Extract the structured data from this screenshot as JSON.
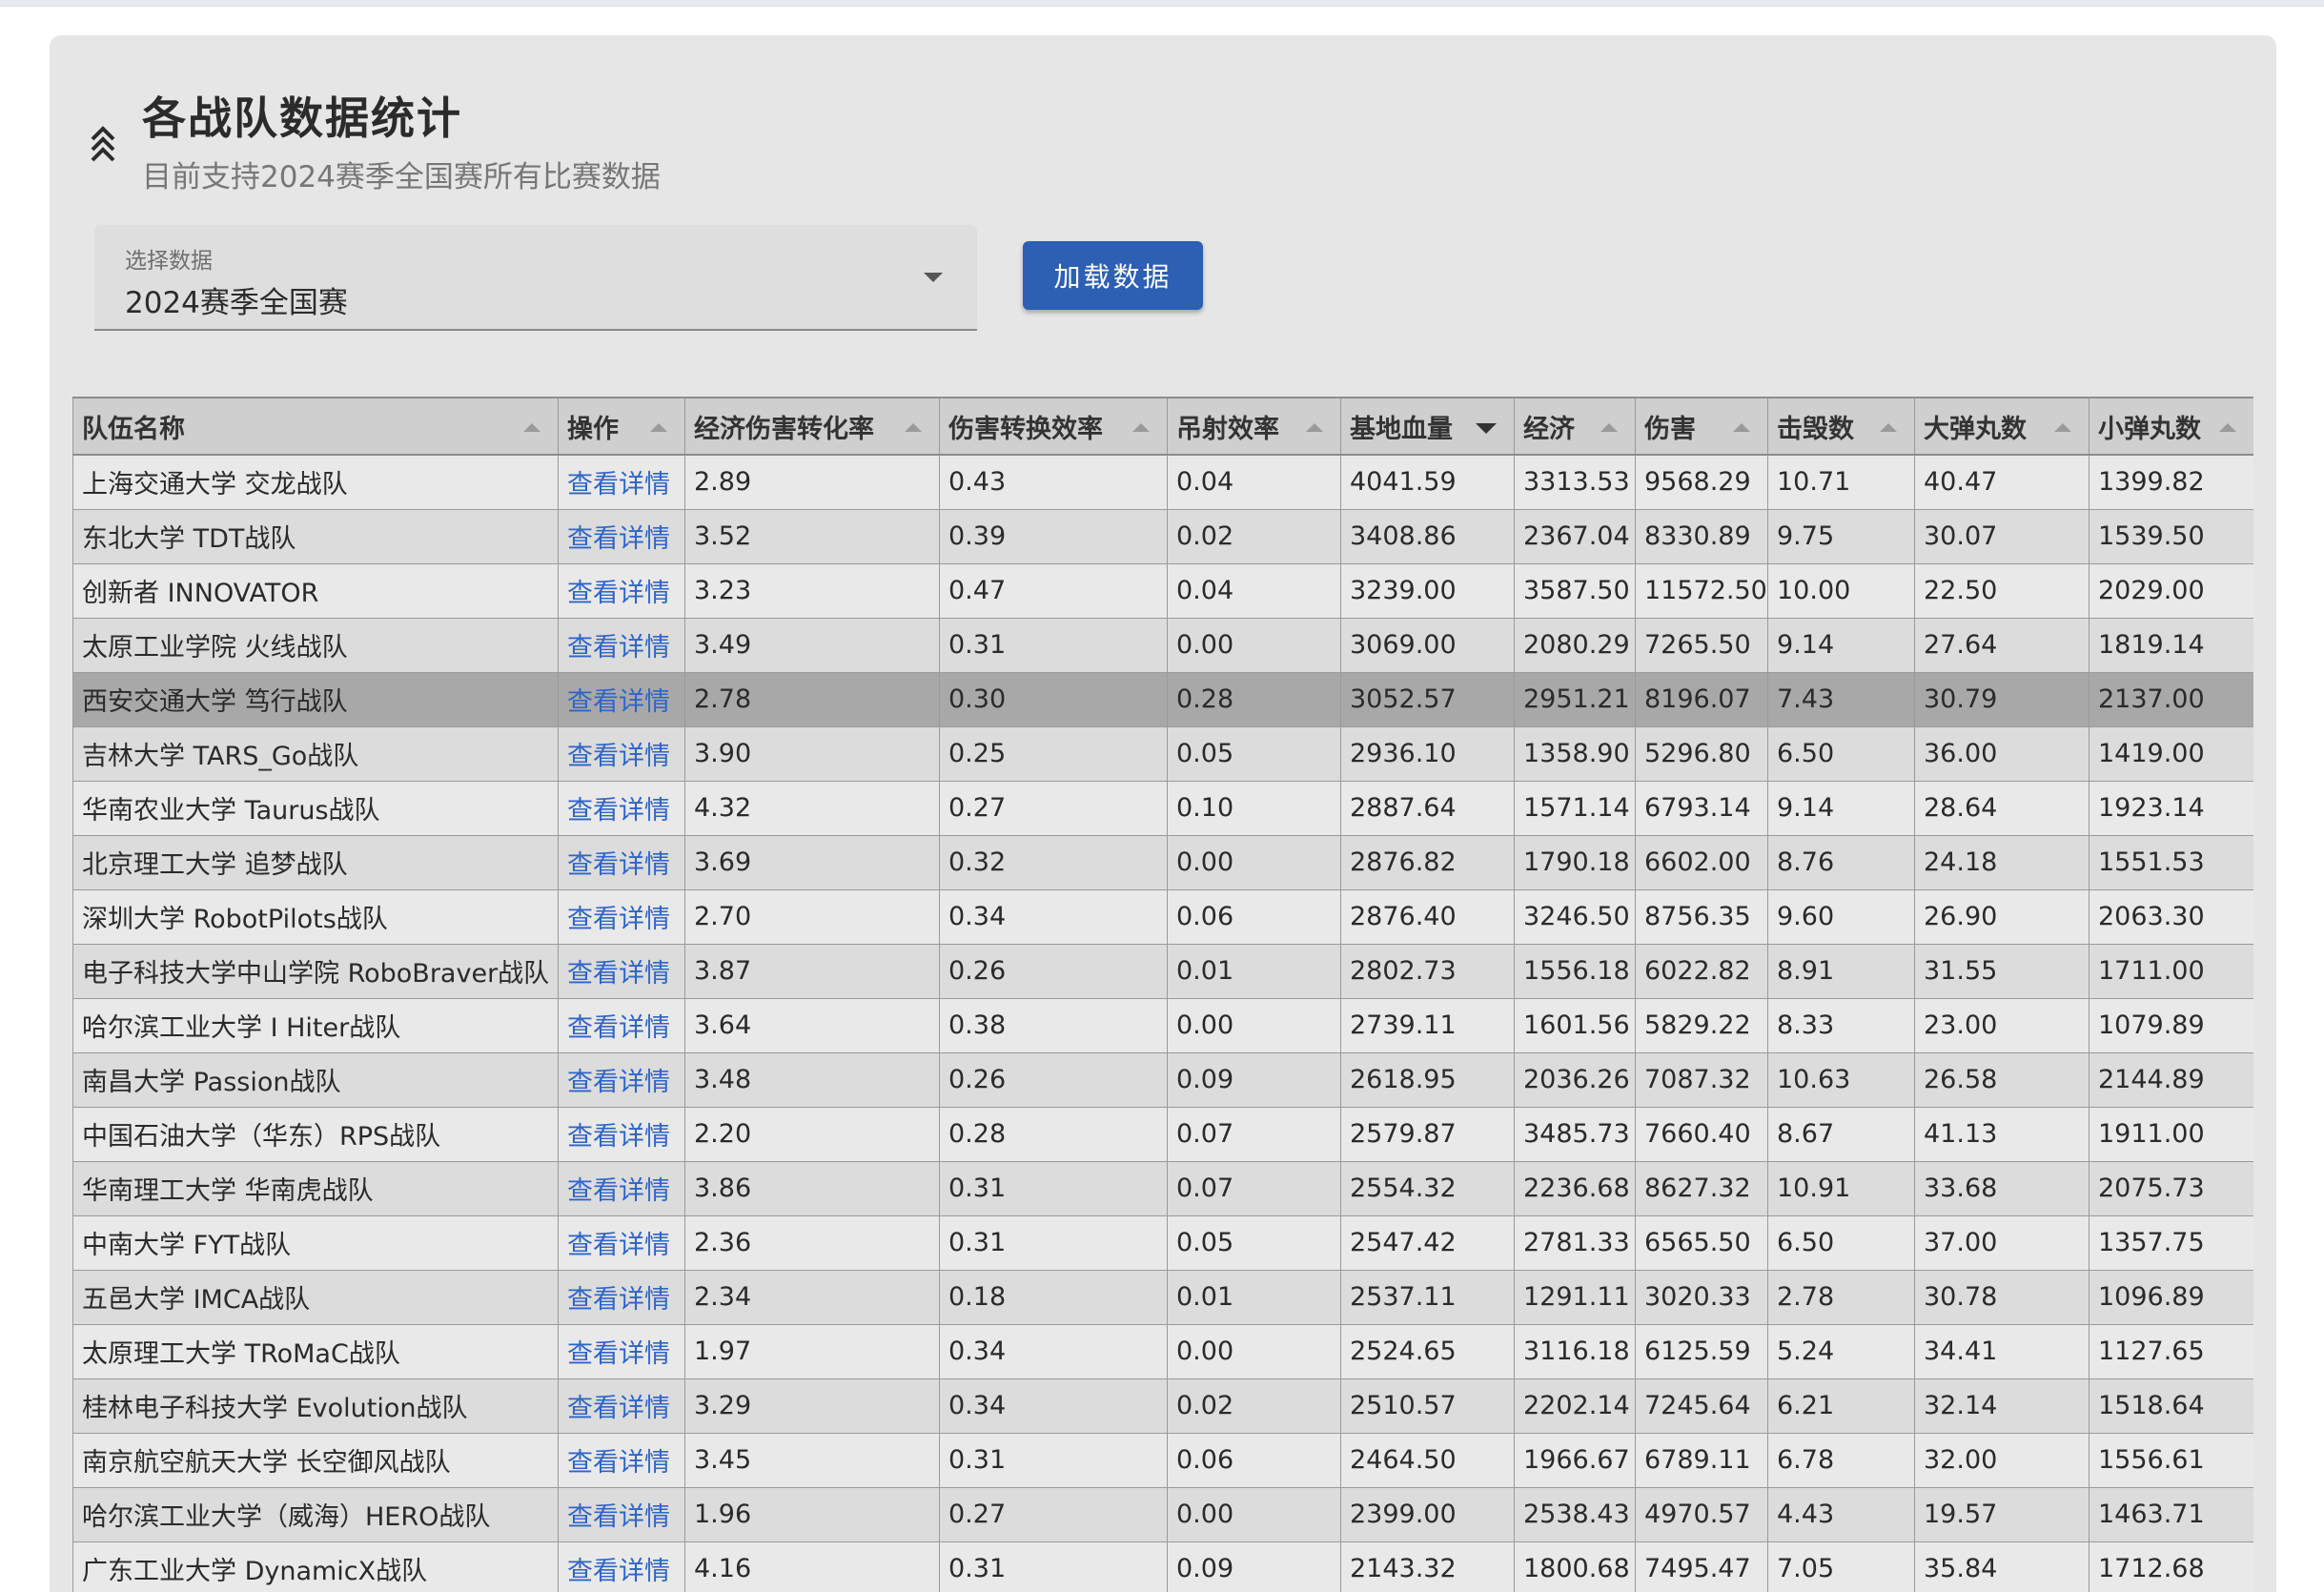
{
  "header": {
    "title": "各战队数据统计",
    "subtitle": "目前支持2024赛季全国赛所有比赛数据"
  },
  "select": {
    "label": "选择数据",
    "value": "2024赛季全国赛"
  },
  "load_button": "加载数据",
  "table": {
    "columns": [
      "队伍名称",
      "操作",
      "经济伤害转化率",
      "伤害转换效率",
      "吊射效率",
      "基地血量",
      "经济",
      "伤害",
      "击毁数",
      "大弹丸数",
      "小弹丸数"
    ],
    "sorted_column": "基地血量",
    "sort_direction": "descending",
    "highlighted_row": 4,
    "rows": [
      [
        "上海交通大学 交龙战队",
        "查看详情",
        "2.89",
        "0.43",
        "0.04",
        "4041.59",
        "3313.53",
        "9568.29",
        "10.71",
        "40.47",
        "1399.82"
      ],
      [
        "东北大学 TDT战队",
        "查看详情",
        "3.52",
        "0.39",
        "0.02",
        "3408.86",
        "2367.04",
        "8330.89",
        "9.75",
        "30.07",
        "1539.50"
      ],
      [
        "创新者 INNOVATOR",
        "查看详情",
        "3.23",
        "0.47",
        "0.04",
        "3239.00",
        "3587.50",
        "11572.50",
        "10.00",
        "22.50",
        "2029.00"
      ],
      [
        "太原工业学院 火线战队",
        "查看详情",
        "3.49",
        "0.31",
        "0.00",
        "3069.00",
        "2080.29",
        "7265.50",
        "9.14",
        "27.64",
        "1819.14"
      ],
      [
        "西安交通大学 笃行战队",
        "查看详情",
        "2.78",
        "0.30",
        "0.28",
        "3052.57",
        "2951.21",
        "8196.07",
        "7.43",
        "30.79",
        "2137.00"
      ],
      [
        "吉林大学 TARS_Go战队",
        "查看详情",
        "3.90",
        "0.25",
        "0.05",
        "2936.10",
        "1358.90",
        "5296.80",
        "6.50",
        "36.00",
        "1419.00"
      ],
      [
        "华南农业大学 Taurus战队",
        "查看详情",
        "4.32",
        "0.27",
        "0.10",
        "2887.64",
        "1571.14",
        "6793.14",
        "9.14",
        "28.64",
        "1923.14"
      ],
      [
        "北京理工大学 追梦战队",
        "查看详情",
        "3.69",
        "0.32",
        "0.00",
        "2876.82",
        "1790.18",
        "6602.00",
        "8.76",
        "24.18",
        "1551.53"
      ],
      [
        "深圳大学 RobotPilots战队",
        "查看详情",
        "2.70",
        "0.34",
        "0.06",
        "2876.40",
        "3246.50",
        "8756.35",
        "9.60",
        "26.90",
        "2063.30"
      ],
      [
        "电子科技大学中山学院 RoboBraver战队",
        "查看详情",
        "3.87",
        "0.26",
        "0.01",
        "2802.73",
        "1556.18",
        "6022.82",
        "8.91",
        "31.55",
        "1711.00"
      ],
      [
        "哈尔滨工业大学 I Hiter战队",
        "查看详情",
        "3.64",
        "0.38",
        "0.00",
        "2739.11",
        "1601.56",
        "5829.22",
        "8.33",
        "23.00",
        "1079.89"
      ],
      [
        "南昌大学 Passion战队",
        "查看详情",
        "3.48",
        "0.26",
        "0.09",
        "2618.95",
        "2036.26",
        "7087.32",
        "10.63",
        "26.58",
        "2144.89"
      ],
      [
        "中国石油大学（华东）RPS战队",
        "查看详情",
        "2.20",
        "0.28",
        "0.07",
        "2579.87",
        "3485.73",
        "7660.40",
        "8.67",
        "41.13",
        "1911.00"
      ],
      [
        "华南理工大学 华南虎战队",
        "查看详情",
        "3.86",
        "0.31",
        "0.07",
        "2554.32",
        "2236.68",
        "8627.32",
        "10.91",
        "33.68",
        "2075.73"
      ],
      [
        "中南大学 FYT战队",
        "查看详情",
        "2.36",
        "0.31",
        "0.05",
        "2547.42",
        "2781.33",
        "6565.50",
        "6.50",
        "37.00",
        "1357.75"
      ],
      [
        "五邑大学 IMCA战队",
        "查看详情",
        "2.34",
        "0.18",
        "0.01",
        "2537.11",
        "1291.11",
        "3020.33",
        "2.78",
        "30.78",
        "1096.89"
      ],
      [
        "太原理工大学 TRoMaC战队",
        "查看详情",
        "1.97",
        "0.34",
        "0.00",
        "2524.65",
        "3116.18",
        "6125.59",
        "5.24",
        "34.41",
        "1127.65"
      ],
      [
        "桂林电子科技大学 Evolution战队",
        "查看详情",
        "3.29",
        "0.34",
        "0.02",
        "2510.57",
        "2202.14",
        "7245.64",
        "6.21",
        "32.14",
        "1518.64"
      ],
      [
        "南京航空航天大学 长空御风战队",
        "查看详情",
        "3.45",
        "0.31",
        "0.06",
        "2464.50",
        "1966.67",
        "6789.11",
        "6.78",
        "32.00",
        "1556.61"
      ],
      [
        "哈尔滨工业大学（威海）HERO战队",
        "查看详情",
        "1.96",
        "0.27",
        "0.00",
        "2399.00",
        "2538.43",
        "4970.57",
        "4.43",
        "19.57",
        "1463.71"
      ],
      [
        "广东工业大学 DynamicX战队",
        "查看详情",
        "4.16",
        "0.31",
        "0.09",
        "2143.32",
        "1800.68",
        "7495.47",
        "7.05",
        "35.84",
        "1712.68"
      ]
    ]
  },
  "colors": {
    "accent": "#2d5fb3",
    "link": "#2f64c8",
    "highlight_row": "#a8a8a8",
    "card_bg": "#e6e6e6"
  },
  "icons": {
    "collapse": "double-chevron-up-icon",
    "dropdown": "caret-down-icon",
    "sort": "sort-arrow-icon"
  }
}
